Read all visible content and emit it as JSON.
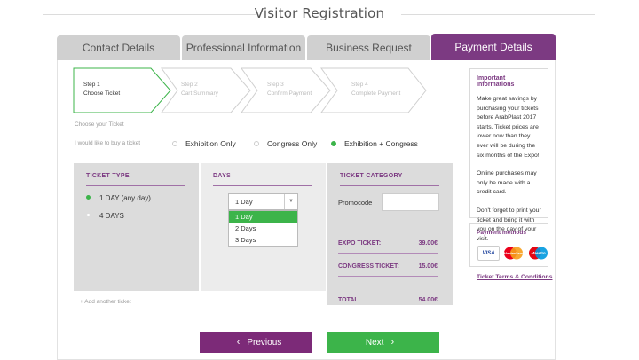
{
  "page": {
    "title": "Visitor Registration"
  },
  "tabs": [
    {
      "label": "Contact Details",
      "active": false
    },
    {
      "label": "Professional Information",
      "active": false
    },
    {
      "label": "Business Request",
      "active": false
    },
    {
      "label": "Payment Details",
      "active": true
    }
  ],
  "steps": [
    {
      "number": "Step 1",
      "label": "Choose Ticket",
      "active": true
    },
    {
      "number": "Step 2",
      "label": "Cart Summary",
      "active": false
    },
    {
      "number": "Step 3",
      "label": "Confirm Payment",
      "active": false
    },
    {
      "number": "Step 4",
      "label": "Complete Payment",
      "active": false
    }
  ],
  "choose": {
    "heading": "Choose your Ticket",
    "prompt": "I would like to buy a ticket",
    "options": [
      "Exhibition Only",
      "Congress Only",
      "Exhibition + Congress"
    ],
    "selected_index": 2
  },
  "ticket_type": {
    "heading": "TICKET TYPE",
    "options": [
      "1 DAY (any day)",
      "4 DAYS"
    ],
    "selected_index": 0
  },
  "days": {
    "heading": "DAYS",
    "selected": "1 Day",
    "options": [
      "1 Day",
      "2 Days",
      "3 Days"
    ],
    "highlighted_index": 0
  },
  "ticket_category": {
    "heading": "TICKET CATEGORY",
    "promocode_label": "Promocode",
    "promocode_value": "",
    "expo_label": "EXPO TICKET:",
    "expo_value": "39.00€",
    "congress_label": "CONGRESS TICKET:",
    "congress_value": "15.00€",
    "total_label": "TOTAL",
    "total_value": "54.00€"
  },
  "add_ticket": "+ Add another ticket",
  "buttons": {
    "previous": "Previous",
    "next": "Next"
  },
  "info": {
    "heading": "Important Informations",
    "paragraphs": [
      "Make great savings by purchasing your tickets before ArabPlast 2017 starts. Ticket prices are lower now than they ever will be during the six months of the Expo!",
      "Online purchases may only be made with a credit card.",
      "Don't forget to print your ticket and bring it with you on the day of your visit."
    ]
  },
  "payment": {
    "heading": "Payment methods",
    "cards": [
      "VISA",
      "MasterCard",
      "Maestro"
    ]
  },
  "terms_link": "Ticket Terms & Conditions",
  "colors": {
    "brand_purple": "#7c3a82",
    "accent_green": "#3cb44a",
    "tab_grey": "#d0d0d0"
  }
}
